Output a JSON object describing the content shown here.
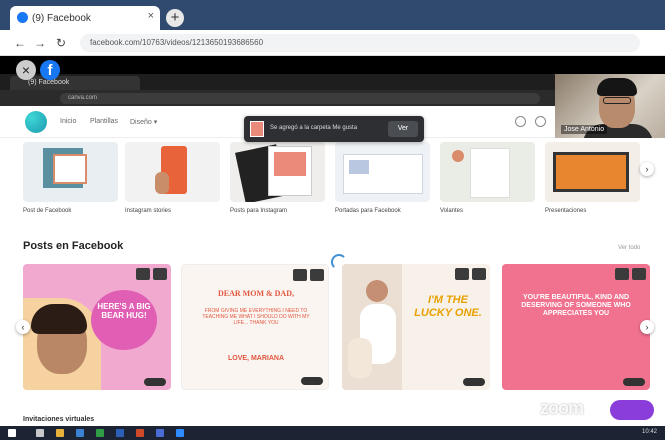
{
  "outer_browser": {
    "tab_title": "(9) Facebook",
    "tab_close": "×",
    "new_tab": "+",
    "nav": {
      "back": "←",
      "forward": "→",
      "reload": "↻"
    },
    "url": "facebook.com/10763/videos/1213650193686560"
  },
  "meeting": {
    "close": "×",
    "facebook_letter": "f"
  },
  "inner_browser": {
    "tab_title": "(9) Facebook",
    "url": "canva.com"
  },
  "webcam": {
    "participant_name": "Jose Antonio"
  },
  "canva_header": {
    "nav": [
      "Inicio",
      "Plantillas",
      "Diseño ▾"
    ]
  },
  "toast": {
    "message": "Se agregó a la carpeta Me gusta",
    "button": "Ver"
  },
  "categories": [
    {
      "label": "Post de Facebook"
    },
    {
      "label": "Instagram stories"
    },
    {
      "label": "Posts para Instagram"
    },
    {
      "label": "Portadas para Facebook"
    },
    {
      "label": "Volantes"
    },
    {
      "label": "Presentaciones"
    }
  ],
  "section": {
    "title": "Posts en Facebook",
    "see_all": "Ver todo"
  },
  "posts": [
    {
      "text": "HERE'S A BIG BEAR HUG!"
    },
    {
      "text": "DEAR MOM & DAD,",
      "body": "FROM GIVING ME EVERYTHING I NEED TO TEACHING ME WHAT I SHOULD DO WITH MY LIFE... THANK YOU",
      "signoff": "LOVE, MARIANA"
    },
    {
      "text": "I'M THE LUCKY ONE."
    },
    {
      "text": "YOU'RE BEAUTIFUL, KIND AND DESERVING OF SOMEONE WHO APPRECIATES YOU"
    }
  ],
  "bottom": {
    "partial_heading": "Invitaciones virtuales"
  },
  "watermark": "zoom",
  "taskbar": {
    "clock": "10:42"
  },
  "colors": {
    "outer_tabs": "#2f4a6e",
    "canva_teal": "#1b9bb0",
    "post_pink": "#f2a9cf",
    "post_coral": "#f0728f",
    "zoom_purple": "#8a3ddb"
  }
}
